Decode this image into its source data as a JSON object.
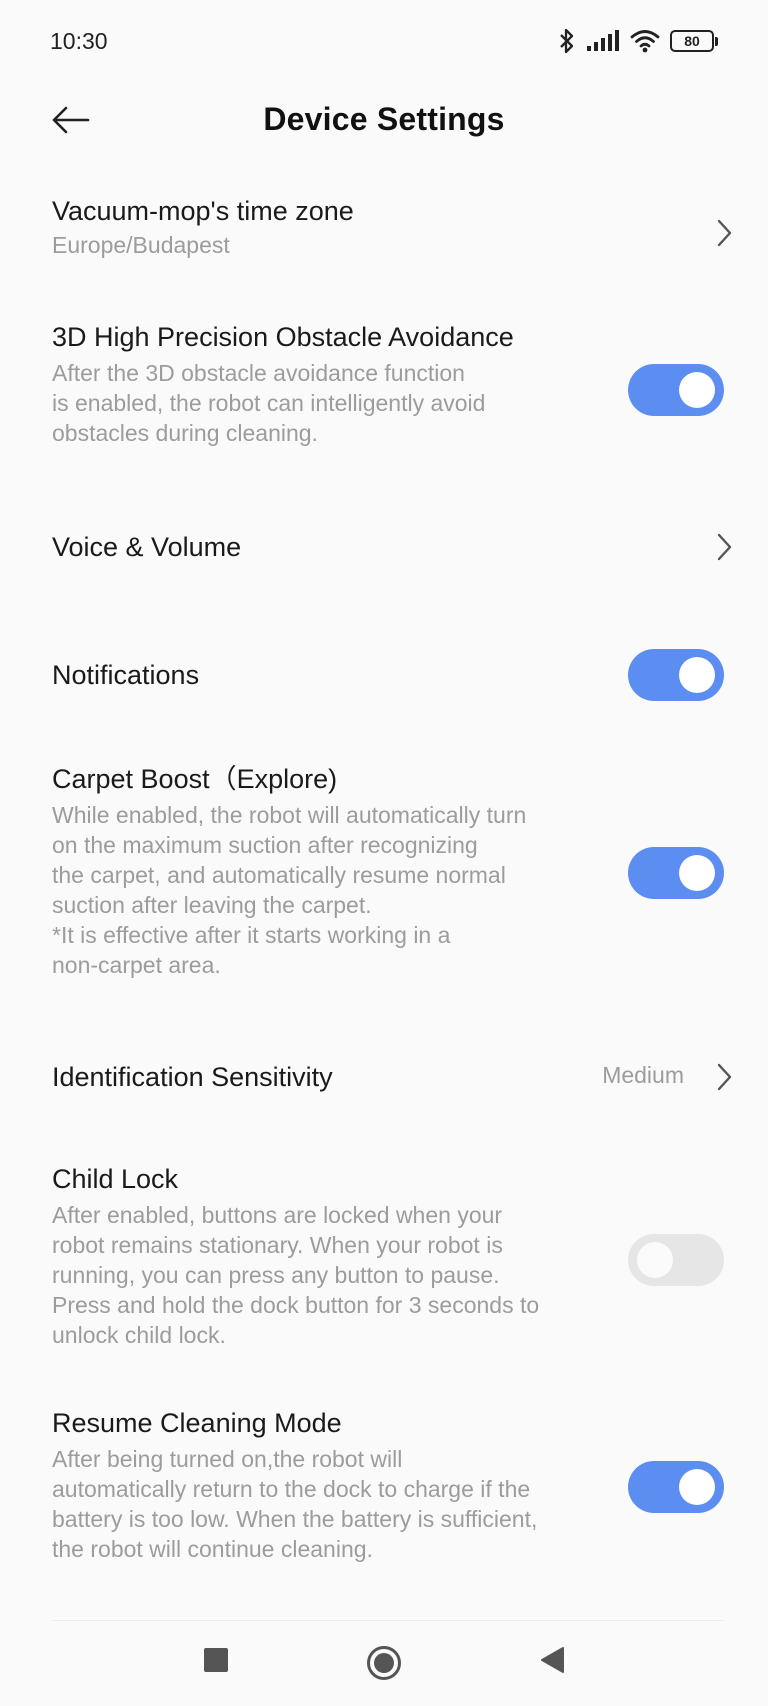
{
  "status_bar": {
    "time": "10:30",
    "battery_level": "80",
    "icons": [
      "bluetooth-icon",
      "signal-icon",
      "wifi-icon",
      "battery-icon"
    ]
  },
  "header": {
    "title": "Device Settings",
    "back_icon": "arrow-left-icon"
  },
  "colors": {
    "toggle_on": "#5b8ef0",
    "toggle_off": "#e6e6e6",
    "secondary_text": "#9c9c9c"
  },
  "settings": {
    "time_zone": {
      "title": "Vacuum-mop's time zone",
      "value": "Europe/Budapest"
    },
    "obstacle_avoidance": {
      "title": "3D High Precision Obstacle Avoidance",
      "desc_lines": [
        "After the 3D obstacle avoidance function",
        "is enabled, the robot can intelligently avoid",
        "obstacles during cleaning."
      ],
      "enabled": true
    },
    "voice_volume": {
      "title": "Voice & Volume"
    },
    "notifications": {
      "title": "Notifications",
      "enabled": true
    },
    "carpet_boost": {
      "title": "Carpet Boost（Explore)",
      "desc_lines": [
        "While enabled, the robot will automatically turn",
        "on the maximum suction after recognizing",
        "the carpet, and automatically resume normal",
        "suction after leaving the carpet.",
        "*It is effective after it starts working in a",
        "non-carpet area."
      ],
      "enabled": true
    },
    "identification_sensitivity": {
      "title": "Identification Sensitivity",
      "value": "Medium"
    },
    "child_lock": {
      "title": "Child Lock",
      "desc_lines": [
        "After enabled, buttons are locked when your",
        "robot remains stationary. When your robot is",
        "running, you can press any button to pause.",
        "Press and hold the dock button for 3 seconds to",
        "unlock child lock."
      ],
      "enabled": false
    },
    "resume_cleaning": {
      "title": "Resume Cleaning Mode",
      "desc_lines": [
        "After being turned on,the robot will",
        "automatically return to the dock to charge if the",
        "battery is too low. When the battery is sufficient,",
        "the robot will continue cleaning."
      ],
      "enabled": true
    }
  },
  "nav_bar": {
    "icons": [
      "recents-square-icon",
      "home-circle-icon",
      "back-triangle-icon"
    ]
  }
}
